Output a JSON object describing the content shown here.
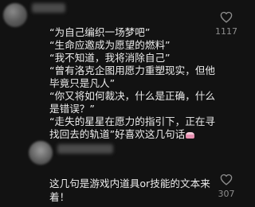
{
  "comment1": {
    "lines": [
      "“为自己编织一场梦吧”",
      "“生命应邀成为愿望的燃料”",
      "“我不知道，我将消除自己”",
      "“曾有洛克企图用愿力重塑现实，但他",
      "毕竟只是凡人”",
      "“你又将如何裁决，什么是正确，什么",
      "是错误？”",
      "“走失的星星在愿力的指引下，正在寻",
      "找回去的轨道”好喜欢这几句话"
    ],
    "emoji": "cake-emoji",
    "likes": "1117"
  },
  "comment2": {
    "lines": [
      "这几句是游戏内道具or技能的文本来",
      "着！"
    ],
    "likes": "307"
  }
}
